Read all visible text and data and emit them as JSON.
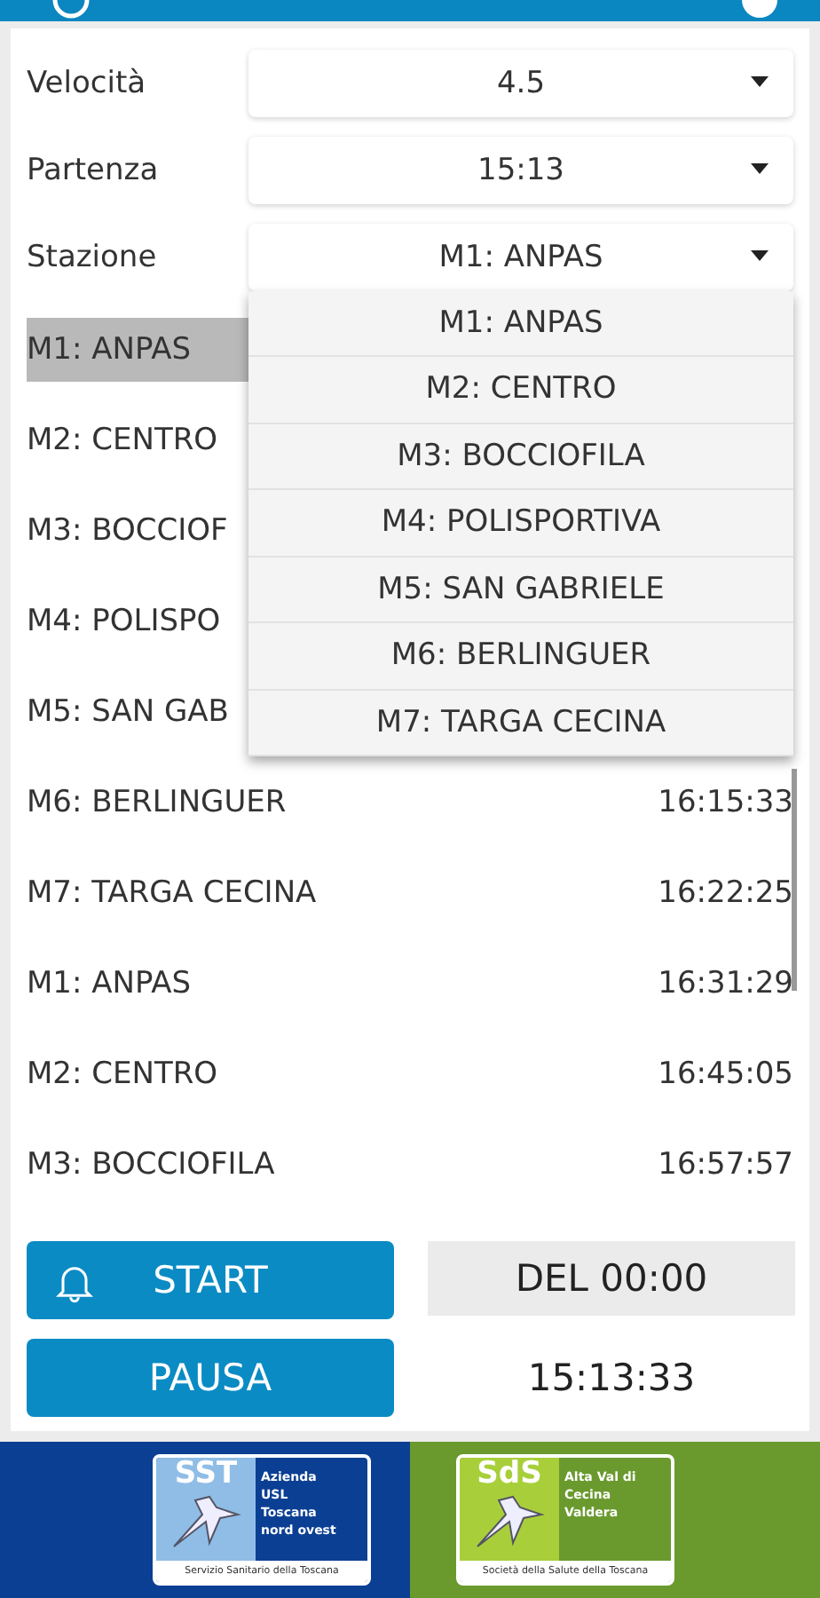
{
  "form": [
    {
      "label": "Velocità",
      "value": "4.5"
    },
    {
      "label": "Partenza",
      "value": "15:13"
    },
    {
      "label": "Stazione",
      "value": "M1: ANPAS",
      "open": true
    }
  ],
  "dropdown_options": [
    "M1: ANPAS",
    "M2: CENTRO",
    "M3: BOCCIOFILA",
    "M4: POLISPORTIVA",
    "M5: SAN GABRIELE",
    "M6: BERLINGUER",
    "M7: TARGA CECINA"
  ],
  "schedule": [
    {
      "station": "M1: ANPAS",
      "selected": true
    },
    {
      "station": "M2: CENTRO",
      "selected": false
    },
    {
      "station": "M3: BOCCIOF",
      "selected": false
    },
    {
      "station": "M4: POLISPO",
      "selected": false
    },
    {
      "station": "M5: SAN GAB",
      "selected": false
    },
    {
      "station": "M6: BERLINGUER",
      "time": "16:15:33",
      "selected": false
    },
    {
      "station": "M7: TARGA CECINA",
      "time": "16:22:25",
      "selected": false
    },
    {
      "station": "M1: ANPAS",
      "time": "16:31:29",
      "selected": false
    },
    {
      "station": "M2: CENTRO",
      "time": "16:45:05",
      "selected": false
    },
    {
      "station": "M3: BOCCIOFILA",
      "time": "16:57:57",
      "selected": false
    }
  ],
  "controls": {
    "start": "START",
    "pause": "PAUSA",
    "delay": "DEL 00:00",
    "clock": "15:13:33"
  },
  "footer": {
    "left": {
      "mark": "SST",
      "lines": [
        "Azienda",
        "USL",
        "Toscana",
        "nord ovest"
      ],
      "caption": "Servizio Sanitario della Toscana"
    },
    "right": {
      "mark": "SdS",
      "lines": [
        "Alta Val di",
        "Cecina",
        "Valdera"
      ],
      "caption": "Società della Salute della Toscana"
    }
  }
}
